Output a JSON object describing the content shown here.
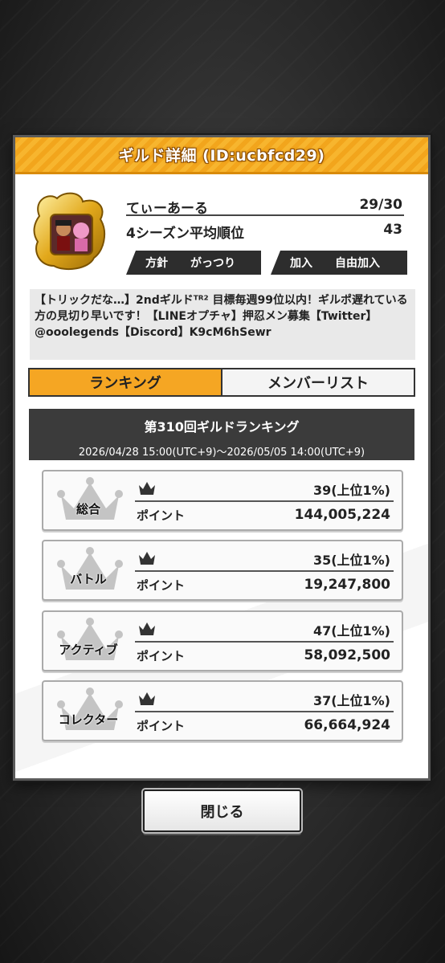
{
  "dialog": {
    "title": "ギルド詳細 (ID:ucbfcd29)"
  },
  "guild": {
    "name": "てぃーあーる",
    "members": "29/30",
    "avg_rank_label": "4シーズン平均順位",
    "avg_rank_value": "43",
    "policy_label": "方針",
    "policy_value": "がっつり",
    "join_label": "加入",
    "join_value": "自由加入",
    "description": "【トリックだな…】2ndギルドᵀᴿ² 目標毎週99位以内！ギルポ遅れている方の見切り早いです！【LINEオプチャ】押忍メン募集【Twitter】@ooolegends【Discord】K9cM6hSewr"
  },
  "tabs": {
    "ranking": "ランキング",
    "member_list": "メンバーリスト"
  },
  "ranking": {
    "title": "第310回ギルドランキング",
    "period": "2026/04/28 15:00(UTC+9)〜2026/05/05 14:00(UTC+9)",
    "points_label": "ポイント",
    "entries": [
      {
        "category": "総合",
        "rank": "39(上位1%)",
        "points": "144,005,224"
      },
      {
        "category": "バトル",
        "rank": "35(上位1%)",
        "points": "19,247,800"
      },
      {
        "category": "アクティブ",
        "rank": "47(上位1%)",
        "points": "58,092,500"
      },
      {
        "category": "コレクター",
        "rank": "37(上位1%)",
        "points": "66,664,924"
      }
    ]
  },
  "buttons": {
    "close": "閉じる"
  },
  "colors": {
    "accent": "#f5a623",
    "title_bar": "#f2a51c",
    "dark": "#3b3b3b"
  }
}
